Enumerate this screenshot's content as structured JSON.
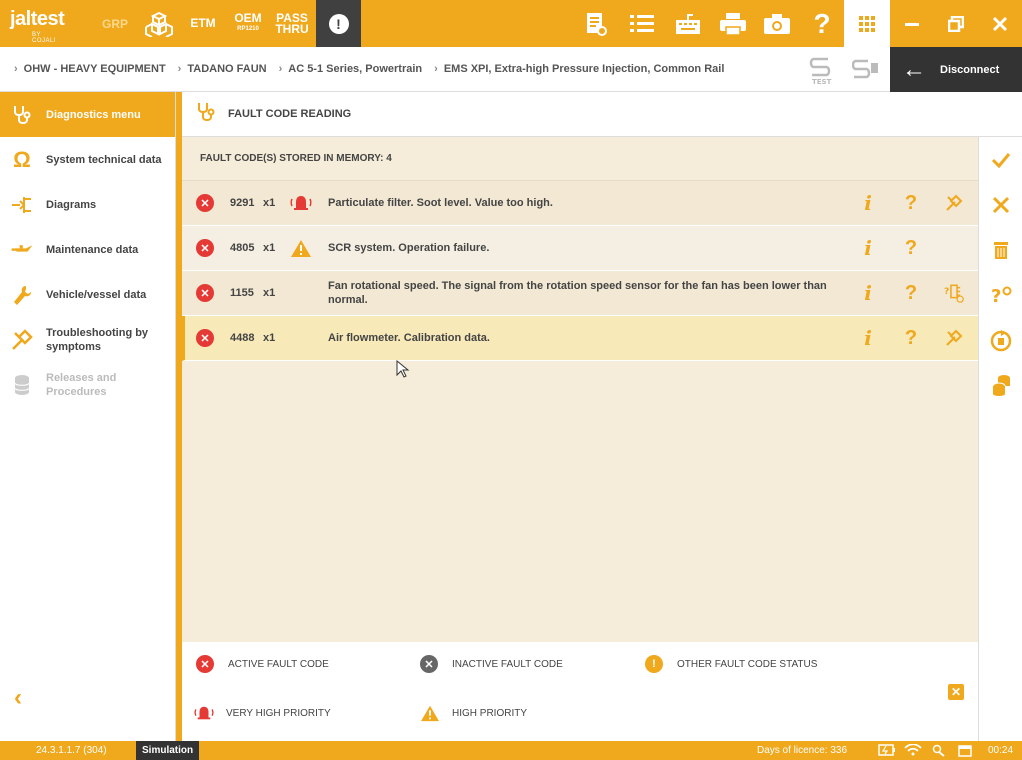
{
  "app": {
    "logo_text": "jaltest",
    "logo_sub": "BY COJALI",
    "toolbar": {
      "grp": "GRP",
      "etm": "ETM",
      "oem": "OEM",
      "oem_sub": "RP1210",
      "pass": "PASS",
      "thru": "THRU",
      "alert": "!"
    }
  },
  "breadcrumb": [
    "OHW - HEAVY EQUIPMENT",
    "TADANO FAUN",
    "AC 5-1 Series, Powertrain",
    "EMS XPI, Extra-high Pressure Injection, Common Rail"
  ],
  "disconnect_label": "Disconnect",
  "sidebar": {
    "items": [
      {
        "label": "Diagnostics menu",
        "icon": "stethoscope-icon",
        "state": "active"
      },
      {
        "label": "System technical data",
        "icon": "ohm-icon",
        "state": "normal"
      },
      {
        "label": "Diagrams",
        "icon": "diagram-icon",
        "state": "normal"
      },
      {
        "label": "Maintenance data",
        "icon": "oil-can-icon",
        "state": "normal"
      },
      {
        "label": "Vehicle/vessel data",
        "icon": "wrench-icon",
        "state": "normal"
      },
      {
        "label": "Troubleshooting by symptoms",
        "icon": "tools-icon",
        "state": "normal"
      },
      {
        "label": "Releases and Procedures",
        "icon": "database-icon",
        "state": "disabled"
      }
    ],
    "back": "‹"
  },
  "content": {
    "title": "FAULT CODE READING",
    "panel_title": "FAULT CODE(S) STORED IN MEMORY: 4",
    "faults": [
      {
        "code": "9291",
        "count": "x1",
        "priority": "very-high",
        "desc": "Particulate filter. Soot level. Value too high.",
        "tool": "repair-icon"
      },
      {
        "code": "4805",
        "count": "x1",
        "priority": "high",
        "desc": "SCR system. Operation failure.",
        "tool": ""
      },
      {
        "code": "1155",
        "count": "x1",
        "priority": "none",
        "desc": "Fan rotational speed. The signal from the rotation speed sensor for the fan has been lower than normal.",
        "tool": "component-test-icon"
      },
      {
        "code": "4488",
        "count": "x1",
        "priority": "none",
        "desc": "Air flowmeter. Calibration data.",
        "tool": "repair-icon"
      }
    ],
    "info_glyph": "i",
    "help_glyph": "?"
  },
  "legend": {
    "active": "ACTIVE FAULT CODE",
    "inactive": "INACTIVE FAULT CODE",
    "other": "OTHER FAULT CODE STATUS",
    "very_high": "VERY HIGH PRIORITY",
    "high": "HIGH PRIORITY"
  },
  "status": {
    "version": "24.3.1.1.7 (304)",
    "mode": "Simulation",
    "days": "Days of licence: 336",
    "time": "00:24"
  },
  "colors": {
    "accent": "#f0a81c",
    "error": "#e53935",
    "dark": "#333333"
  }
}
